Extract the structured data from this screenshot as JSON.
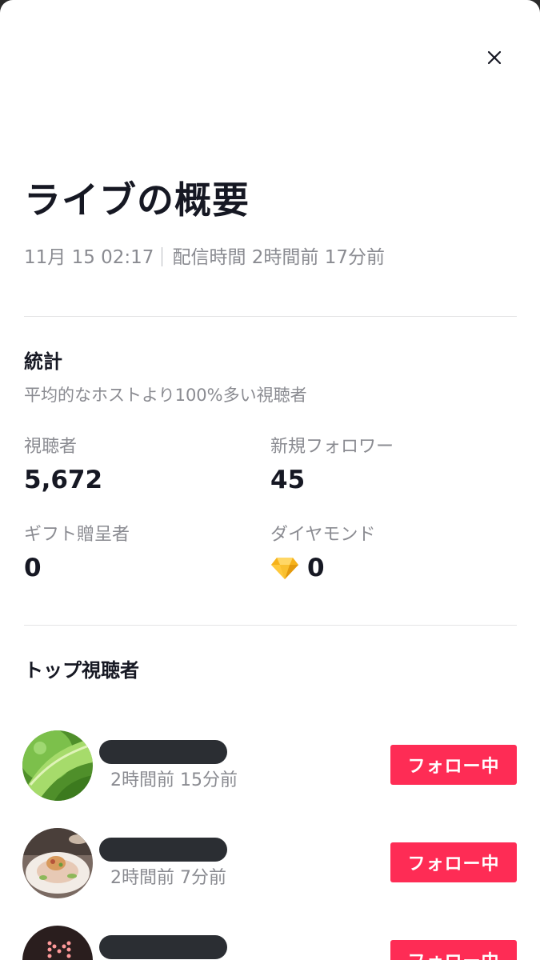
{
  "header": {
    "title": "ライブの概要",
    "date": "11月 15 02:17",
    "duration": "配信時間 2時間前 17分前",
    "close_icon": "close-icon"
  },
  "stats": {
    "section_title": "統計",
    "comparison": "平均的なホストより100%多い視聴者",
    "viewers": {
      "label": "視聴者",
      "value": "5,672"
    },
    "new_followers": {
      "label": "新規フォロワー",
      "value": "45"
    },
    "gifters": {
      "label": "ギフト贈呈者",
      "value": "0"
    },
    "diamonds": {
      "label": "ダイヤモンド",
      "value": "0",
      "icon": "diamond-icon"
    }
  },
  "top_viewers": {
    "section_title": "トップ視聴者",
    "items": [
      {
        "time": "2時間前 15分前",
        "button": "フォロー中",
        "avatar": "leaf-photo"
      },
      {
        "time": "2時間前 7分前",
        "button": "フォロー中",
        "avatar": "food-plate-photo"
      },
      {
        "time": "",
        "button": "フォロー中",
        "avatar": "dark-sign-photo"
      }
    ]
  },
  "colors": {
    "accent": "#fe2c55",
    "text_primary": "#161823",
    "text_secondary": "#8a8b91",
    "divider": "#e3e3e5"
  }
}
